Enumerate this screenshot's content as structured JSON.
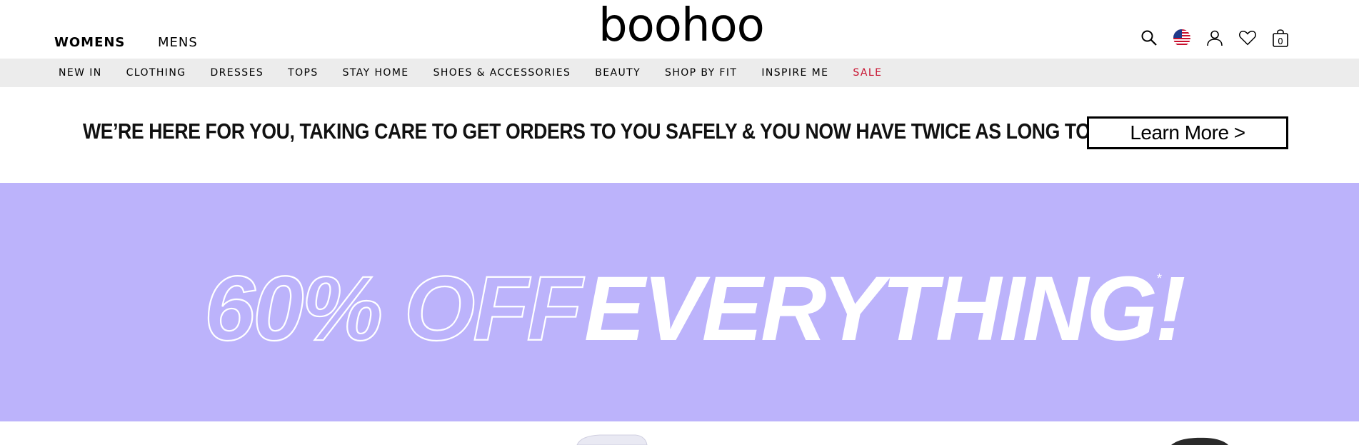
{
  "header": {
    "genders": [
      "WOMENS",
      "MENS"
    ],
    "logo": "boohoo",
    "bag_count": "0",
    "icons": [
      "search-icon",
      "us-flag-icon",
      "account-icon",
      "wishlist-heart-icon",
      "bag-icon"
    ]
  },
  "nav": {
    "items": [
      "NEW IN",
      "CLOTHING",
      "DRESSES",
      "TOPS",
      "STAY HOME",
      "SHOES & ACCESSORIES",
      "BEAUTY",
      "SHOP BY FIT",
      "INSPIRE ME",
      "SALE"
    ]
  },
  "notice": {
    "text": "WE’RE HERE FOR YOU, TAKING CARE TO GET ORDERS TO YOU SAFELY & YOU NOW HAVE TWICE AS LONG TO RETURN.",
    "button_label": "Learn More >"
  },
  "hero": {
    "outline_text": "60% OFF",
    "solid_text": "EVERYTHING!",
    "asterisk": "*",
    "background_color": "#bcb3fb",
    "text_color": "#ffffff"
  },
  "colors": {
    "sale": "#c8102e",
    "nav_background": "#ececec"
  }
}
